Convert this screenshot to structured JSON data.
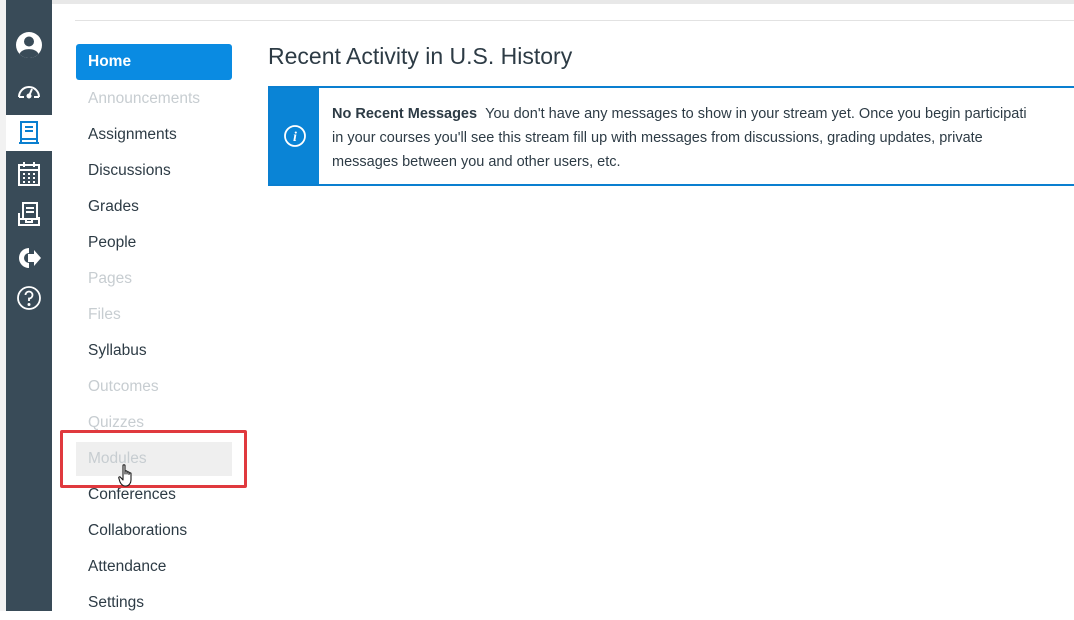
{
  "global_nav": {
    "items": [
      {
        "name": "account-avatar-icon"
      },
      {
        "name": "dashboard-icon"
      },
      {
        "name": "courses-icon",
        "active": true
      },
      {
        "name": "calendar-icon"
      },
      {
        "name": "inbox-icon"
      },
      {
        "name": "commons-icon"
      },
      {
        "name": "help-icon"
      }
    ],
    "bg_color": "#394b58"
  },
  "course_nav": {
    "items": [
      {
        "label": "Home",
        "state": "active"
      },
      {
        "label": "Announcements",
        "state": "disabled"
      },
      {
        "label": "Assignments",
        "state": "enabled"
      },
      {
        "label": "Discussions",
        "state": "enabled"
      },
      {
        "label": "Grades",
        "state": "enabled"
      },
      {
        "label": "People",
        "state": "enabled"
      },
      {
        "label": "Pages",
        "state": "disabled"
      },
      {
        "label": "Files",
        "state": "disabled"
      },
      {
        "label": "Syllabus",
        "state": "enabled"
      },
      {
        "label": "Outcomes",
        "state": "disabled"
      },
      {
        "label": "Quizzes",
        "state": "disabled"
      },
      {
        "label": "Modules",
        "state": "disabled-hover"
      },
      {
        "label": "Conferences",
        "state": "enabled"
      },
      {
        "label": "Collaborations",
        "state": "enabled"
      },
      {
        "label": "Attendance",
        "state": "enabled"
      },
      {
        "label": "Settings",
        "state": "enabled"
      }
    ],
    "accent_color": "#0a8be2",
    "highlight_color": "#e0393e"
  },
  "main": {
    "title": "Recent Activity in U.S. History",
    "alert": {
      "icon": "info-icon",
      "heading": "No Recent Messages",
      "line1": "You don't have any messages to show in your stream yet. Once you begin participati",
      "line2": "in your courses you'll see this stream fill up with messages from discussions, grading updates, private",
      "line3": "messages between you and other users, etc."
    }
  }
}
